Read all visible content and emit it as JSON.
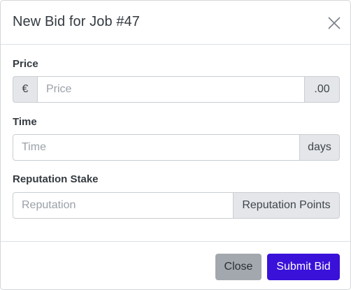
{
  "modal": {
    "title": "New Bid for Job #47",
    "close_icon": "close-x-icon"
  },
  "fields": {
    "price": {
      "label": "Price",
      "prefix": "€",
      "placeholder": "Price",
      "value": "",
      "suffix": ".00"
    },
    "time": {
      "label": "Time",
      "placeholder": "Time",
      "value": "",
      "suffix": "days"
    },
    "reputation": {
      "label": "Reputation Stake",
      "placeholder": "Reputation",
      "value": "",
      "suffix": "Reputation Points"
    }
  },
  "footer": {
    "close_label": "Close",
    "submit_label": "Submit Bid"
  },
  "colors": {
    "primary": "#3a11d9",
    "secondary": "#a3a8ae"
  }
}
